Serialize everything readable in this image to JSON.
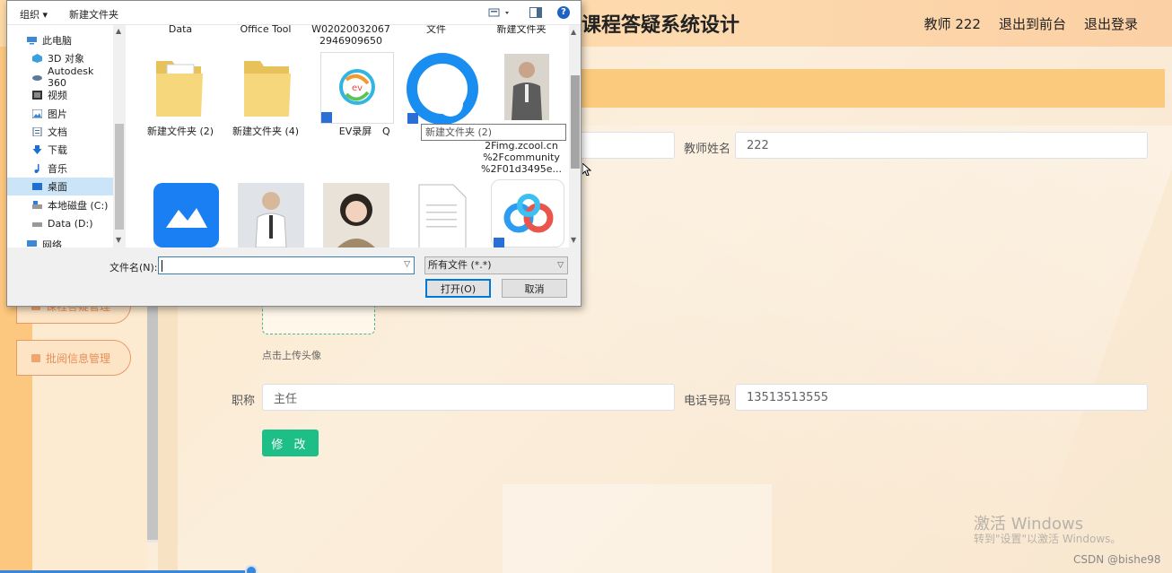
{
  "app": {
    "title": "课程答疑系统设计",
    "nav": {
      "teacher": "教师 222",
      "to_front": "退出到前台",
      "logout": "退出登录"
    },
    "sidebar": {
      "item1": "课程答疑管理",
      "item2": "批阅信息管理"
    },
    "form": {
      "teacher_name_label": "教师姓名",
      "teacher_name_value": "222",
      "title_label": "职称",
      "title_value": "主任",
      "phone_label": "电话号码",
      "phone_value": "13513513555",
      "avatar_hint": "点击上传头像",
      "submit_label": "修 改"
    },
    "watermark": {
      "line1": "激活 Windows",
      "line2": "转到\"设置\"以激活 Windows。"
    },
    "csdn": "CSDN @bishe98"
  },
  "dialog": {
    "toolbar": {
      "organize": "组织 ▾",
      "new_folder": "新建文件夹"
    },
    "nav_items": [
      {
        "label": "此电脑",
        "icon": "computer-icon"
      },
      {
        "label": "3D 对象",
        "icon": "cube-icon"
      },
      {
        "label": "Autodesk 360",
        "icon": "cloud-icon"
      },
      {
        "label": "视频",
        "icon": "video-icon"
      },
      {
        "label": "图片",
        "icon": "picture-icon"
      },
      {
        "label": "文档",
        "icon": "document-icon"
      },
      {
        "label": "下载",
        "icon": "download-icon"
      },
      {
        "label": "音乐",
        "icon": "music-icon"
      },
      {
        "label": "桌面",
        "icon": "desktop-icon"
      },
      {
        "label": "本地磁盘 (C:)",
        "icon": "drive-icon"
      },
      {
        "label": "Data (D:)",
        "icon": "drive-icon"
      },
      {
        "label": "网络",
        "icon": "network-icon"
      }
    ],
    "top_labels": [
      "Data",
      "Office Tool",
      "W02020032067\n2946909650",
      "文件",
      "新建文件夹"
    ],
    "files_row1": [
      {
        "label": "新建文件夹 (2)",
        "icon": "folder-icon"
      },
      {
        "label": "新建文件夹 (4)",
        "icon": "folder-icon"
      },
      {
        "label": "EV录屏",
        "icon": "ev-recorder-icon"
      },
      {
        "label": "Q",
        "icon": "browser-icon"
      },
      {
        "label": "2Fimg.zcool.cn\n%2Fcommunity\n%2F01d3495e...",
        "icon": "photo-icon"
      }
    ],
    "files_row2_icons": [
      "meeting-app-icon",
      "photo-icon",
      "photo-icon",
      "document-icon",
      "baidu-netdisk-icon"
    ],
    "tooltip": "新建文件夹 (2)",
    "filename_label": "文件名(N):",
    "filename_value": "",
    "filetype": "所有文件 (*.*)",
    "open_label": "打开(O)",
    "cancel_label": "取消"
  }
}
